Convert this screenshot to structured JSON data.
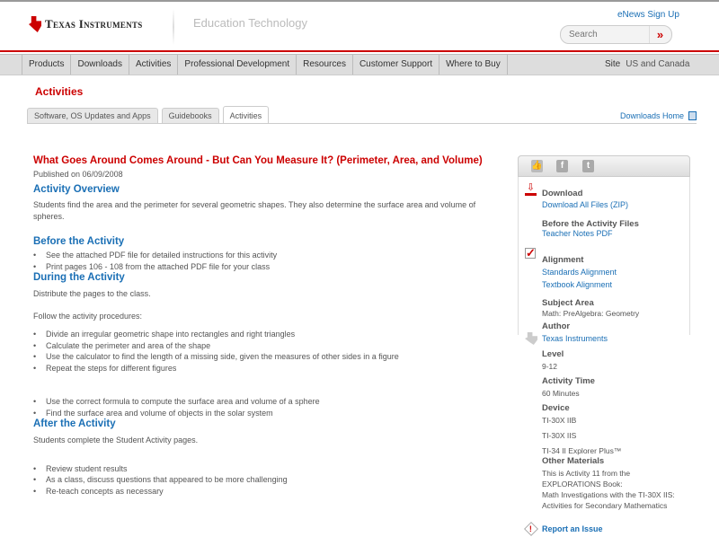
{
  "header": {
    "brand": "Texas Instruments",
    "section": "Education Technology",
    "enews": "eNews Sign Up",
    "search_placeholder": "Search",
    "search_go": "»"
  },
  "nav": {
    "items": [
      "Products",
      "Downloads",
      "Activities",
      "Professional Development",
      "Resources",
      "Customer Support",
      "Where to Buy"
    ],
    "site_label": "Site",
    "site_value": "US and Canada"
  },
  "page_heading": "Activities",
  "tabs": [
    "Software, OS Updates and Apps",
    "Guidebooks",
    "Activities"
  ],
  "downloads_home": "Downloads Home",
  "main": {
    "title": "What Goes Around Comes Around - But Can You Measure It? (Perimeter, Area, and Volume)",
    "published": "Published on 06/09/2008",
    "overview_h": "Activity Overview",
    "overview": "Students find the area and the perimeter for several geometric shapes. They also determine the surface area and volume of spheres.",
    "before_h": "Before the Activity",
    "before": [
      "See the attached PDF file for detailed instructions for this activity",
      "Print pages 106 - 108 from the attached PDF file for your class"
    ],
    "during_h": "During the Activity",
    "during_p1": "Distribute the pages to the class.",
    "during_p2": "Follow the activity procedures:",
    "during_a": [
      "Divide an irregular geometric shape into rectangles and right triangles",
      "Calculate the perimeter and area of the shape",
      "Use the calculator to find the length of a missing side, given the measures of other sides in a figure",
      "Repeat the steps for different figures"
    ],
    "during_b": [
      "Use the correct formula to compute the surface area and volume of a sphere",
      "Find the surface area and volume of objects in the solar system"
    ],
    "after_h": "After the Activity",
    "after_p": "Students complete the Student Activity pages.",
    "after": [
      "Review student results",
      "As a class, discuss questions that appeared to be more challenging",
      "Re-teach concepts as necessary"
    ]
  },
  "sidebar": {
    "download_h": "Download",
    "download_all": "Download All Files (ZIP)",
    "before_files_h": "Before the Activity Files",
    "teacher_notes": "Teacher Notes PDF",
    "alignment_h": "Alignment",
    "standards": "Standards Alignment",
    "textbook": "Textbook Alignment",
    "subject_h": "Subject Area",
    "subject": "Math: PreAlgebra: Geometry",
    "author_h": "Author",
    "author": "Texas Instruments",
    "level_h": "Level",
    "level": "9-12",
    "time_h": "Activity Time",
    "time": "60 Minutes",
    "device_h": "Device",
    "devices": [
      "TI-30X IIB",
      "TI-30X IIS",
      "TI-34 II Explorer Plus™"
    ],
    "other_h": "Other Materials",
    "other": [
      "This is Activity 11 from the",
      "EXPLORATIONS Book:",
      "Math Investigations with the TI-30X IIS:",
      "Activities for Secondary Mathematics"
    ],
    "report": "Report an Issue"
  }
}
